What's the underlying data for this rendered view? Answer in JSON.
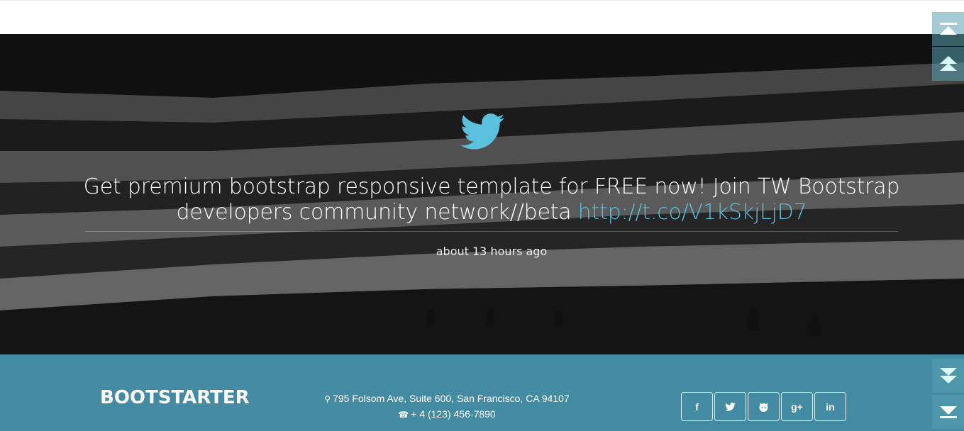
{
  "tweet": {
    "text": "Get premium bootstrap responsive template for FREE now! Join TW Bootstrap developers community network//beta ",
    "link": "http://t.co/V1kSkjLjD7",
    "time": "about 13 hours ago"
  },
  "footer": {
    "brand": "BOOTSTARTER",
    "address": "795 Folsom Ave, Suite 600, San Francisco, CA 94107",
    "phone": "+ 4 (123) 456-7890",
    "social": [
      {
        "name": "facebook-icon",
        "label": "f"
      },
      {
        "name": "twitter-icon",
        "label": ""
      },
      {
        "name": "github-icon",
        "label": ""
      },
      {
        "name": "google-plus-icon",
        "label": "g+"
      },
      {
        "name": "linkedin-icon",
        "label": "in"
      }
    ]
  },
  "colors": {
    "accent": "#5bc0de",
    "footer": "#428ba2",
    "sidebar": "#5aa0af"
  },
  "icons": [
    "twitter-bird-icon",
    "map-marker-icon",
    "phone-icon",
    "scroll-top-icon",
    "page-up-icon",
    "page-down-icon",
    "scroll-bottom-icon"
  ]
}
